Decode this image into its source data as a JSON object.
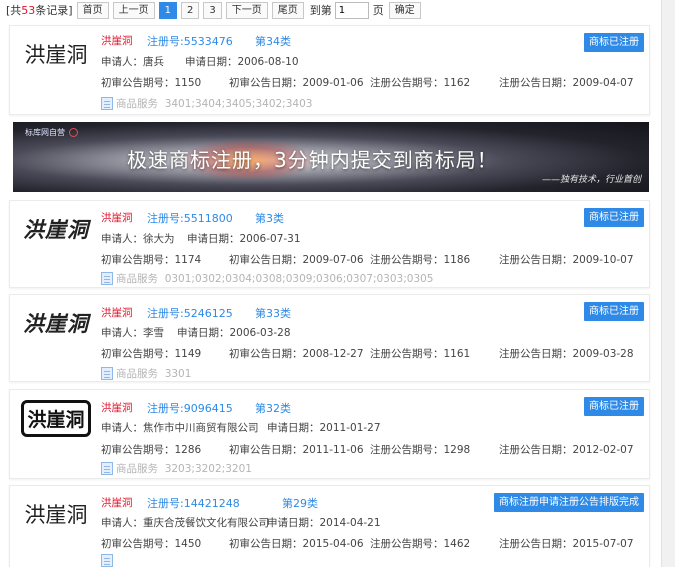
{
  "pager": {
    "total_prefix": "[共",
    "total_count": "53",
    "total_suffix": "条记录]",
    "first": "首页",
    "prev": "上一页",
    "pages": [
      "1",
      "2",
      "3"
    ],
    "current_page": "1",
    "next": "下一页",
    "last": "尾页",
    "goto_label": "到第",
    "page_input_value": "1",
    "page_unit": "页",
    "confirm": "确定"
  },
  "banner": {
    "site": "标库网自营",
    "headline": "极速商标注册，3分钟内提交到商标局！",
    "slogan": "——独有技术，行业首创"
  },
  "records": [
    {
      "logo_text": "洪崖洞",
      "name": "洪崖洞",
      "reg_no": "注册号:5533476",
      "class": "第34类",
      "status": "商标已注册",
      "applicant": "申请人：唐兵",
      "apply_date": "申请日期：2006-08-10",
      "first_trial_no": "初审公告期号：1150",
      "first_trial_date": "初审公告日期：2009-01-06",
      "reg_announce_no": "注册公告期号：1162",
      "reg_announce_date": "注册公告日期：2009-04-07",
      "services_label": "商品服务",
      "services": "3401;3404;3405;3402;3403"
    },
    {
      "logo_text": "洪崖洞",
      "name": "洪崖洞",
      "reg_no": "注册号:5511800",
      "class": "第3类",
      "status": "商标已注册",
      "applicant": "申请人：徐大为",
      "apply_date": "申请日期：2006-07-31",
      "first_trial_no": "初审公告期号：1174",
      "first_trial_date": "初审公告日期：2009-07-06",
      "reg_announce_no": "注册公告期号：1186",
      "reg_announce_date": "注册公告日期：2009-10-07",
      "services_label": "商品服务",
      "services": "0301;0302;0304;0308;0309;0306;0307;0303;0305"
    },
    {
      "logo_text": "洪崖洞",
      "name": "洪崖洞",
      "reg_no": "注册号:5246125",
      "class": "第33类",
      "status": "商标已注册",
      "applicant": "申请人：李雪",
      "apply_date": "申请日期：2006-03-28",
      "first_trial_no": "初审公告期号：1149",
      "first_trial_date": "初审公告日期：2008-12-27",
      "reg_announce_no": "注册公告期号：1161",
      "reg_announce_date": "注册公告日期：2009-03-28",
      "services_label": "商品服务",
      "services": "3301"
    },
    {
      "logo_text": "洪崖洞",
      "name": "洪崖洞",
      "reg_no": "注册号:9096415",
      "class": "第32类",
      "status": "商标已注册",
      "applicant": "申请人：焦作市中川商贸有限公司",
      "apply_date": "申请日期：2011-01-27",
      "first_trial_no": "初审公告期号：1286",
      "first_trial_date": "初审公告日期：2011-11-06",
      "reg_announce_no": "注册公告期号：1298",
      "reg_announce_date": "注册公告日期：2012-02-07",
      "services_label": "商品服务",
      "services": "3203;3202;3201"
    },
    {
      "logo_text": "洪崖洞",
      "name": "洪崖洞",
      "reg_no": "注册号:14421248",
      "class": "第29类",
      "status": "商标注册申请注册公告排版完成",
      "applicant": "申请人：重庆合茂餐饮文化有限公司",
      "apply_date": "申请日期：2014-04-21",
      "first_trial_no": "初审公告期号：1450",
      "first_trial_date": "初审公告日期：2015-04-06",
      "reg_announce_no": "注册公告期号：1462",
      "reg_announce_date": "注册公告日期：2015-07-07"
    }
  ],
  "colors": {
    "accent": "#2e8ae6",
    "brand_red": "#e0142b",
    "muted": "#b4b4b4"
  }
}
